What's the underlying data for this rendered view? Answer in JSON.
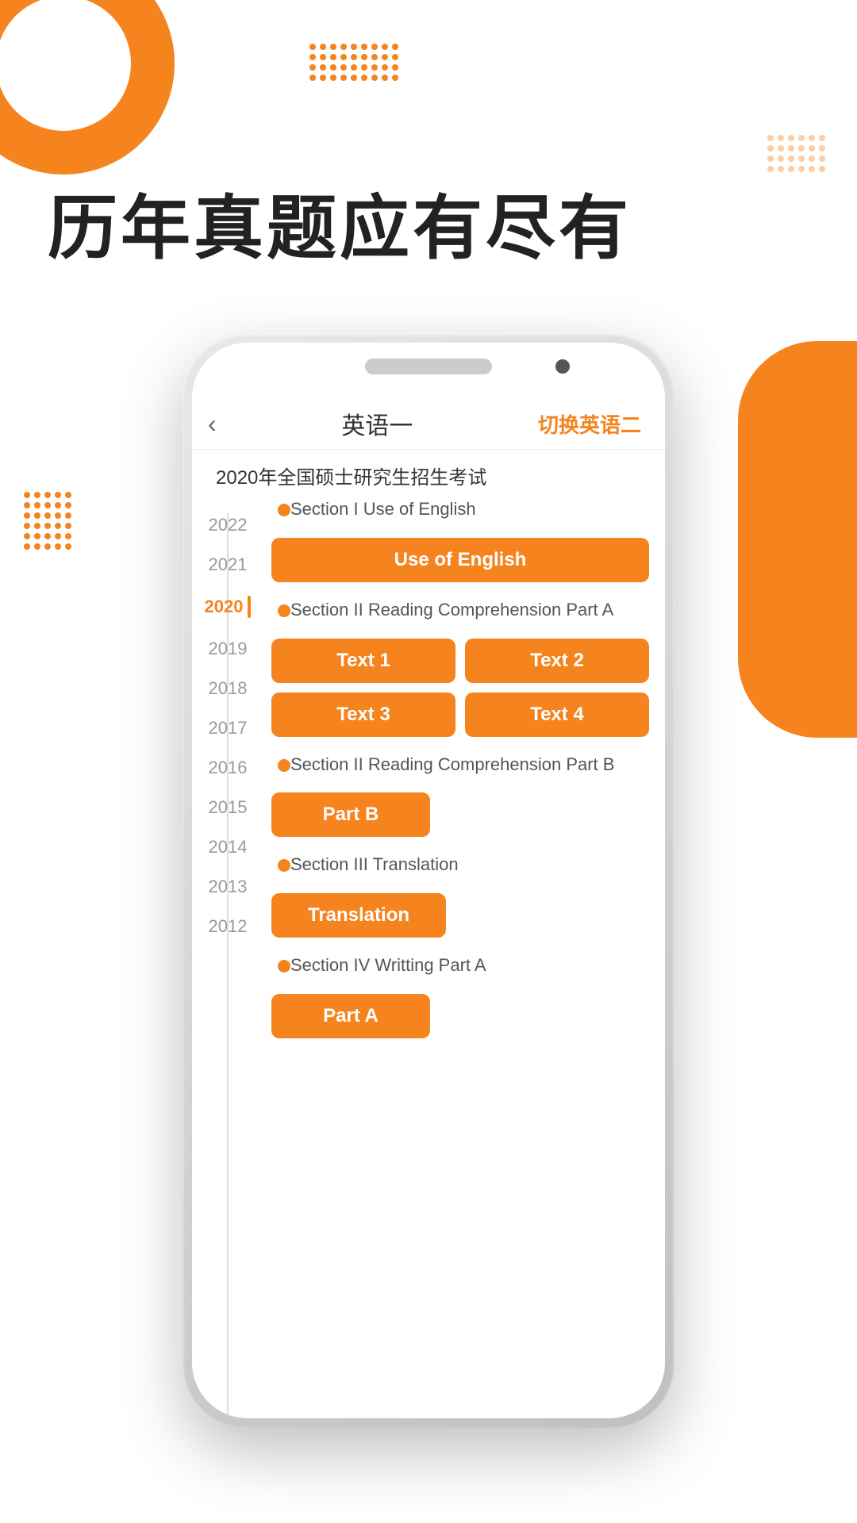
{
  "page": {
    "bg_title": "历年真题应有尽有",
    "phone": {
      "header": {
        "back_label": "‹",
        "title": "英语一",
        "switch_label": "切换英语二"
      },
      "exam_title": "2020年全国硕士研究生招生考试",
      "years": [
        "2022",
        "2021",
        "2020",
        "2019",
        "2018",
        "2017",
        "2016",
        "2015",
        "2014",
        "2013",
        "2012"
      ],
      "active_year": "2020",
      "sections": [
        {
          "id": "section1",
          "label": "Section I Use of English",
          "buttons": [
            {
              "label": "Use of English",
              "width": "full"
            }
          ]
        },
        {
          "id": "section2",
          "label": "Section II Reading Comprehension Part A",
          "buttons": [
            {
              "label": "Text 1"
            },
            {
              "label": "Text 2"
            },
            {
              "label": "Text 3"
            },
            {
              "label": "Text 4"
            }
          ]
        },
        {
          "id": "section3",
          "label": "Section II Reading Comprehension Part B",
          "buttons": [
            {
              "label": "Part B",
              "width": "single"
            }
          ]
        },
        {
          "id": "section4",
          "label": "Section III Translation",
          "buttons": [
            {
              "label": "Translation",
              "width": "single"
            }
          ]
        },
        {
          "id": "section5",
          "label": "Section IV Writting Part A",
          "buttons": [
            {
              "label": "Part A",
              "width": "single"
            }
          ]
        }
      ]
    }
  },
  "colors": {
    "orange": "#f5841f",
    "text_dark": "#222",
    "text_mid": "#555",
    "text_light": "#999"
  }
}
